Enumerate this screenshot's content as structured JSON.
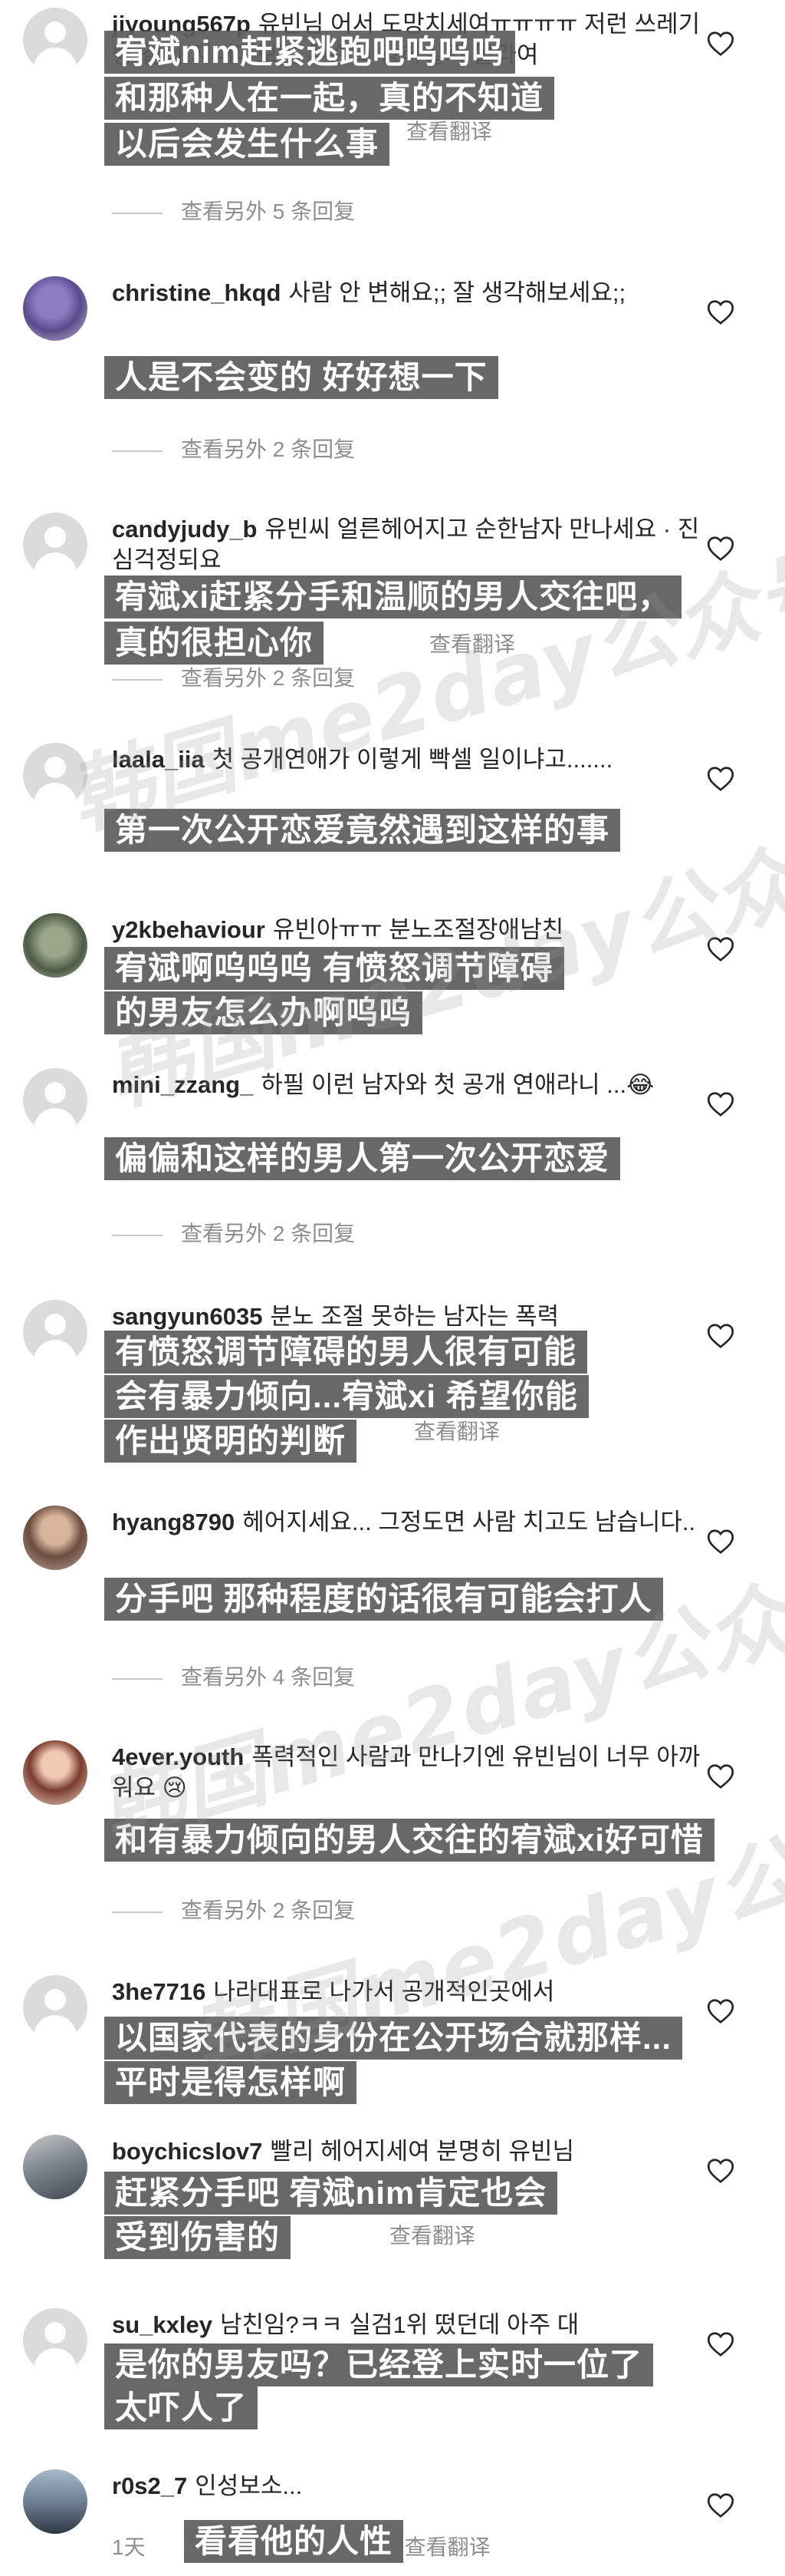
{
  "comments": [
    {
      "username": "jiyoung567p",
      "text": "유빈님 어서 도망치세여ㅠㅠㅠㅠ 저런 쓰레기랑 같이 지내다보면 무슨일 당하실지 몰라여",
      "meta": {
        "time": "",
        "likes": "",
        "reply": "查看翻译"
      },
      "view_replies": "查看另外 5 条回复",
      "subtitle": [
        "宥斌nim赶紧逃跑吧呜呜呜",
        "和那种人在一起，真的不知道",
        "以后会发生什么事"
      ]
    },
    {
      "username": "christine_hkqd",
      "text": "사람 안 변해요;; 잘 생각해보세요;;",
      "view_replies": "查看另外 2 条回复",
      "subtitle": [
        "人是不会变的 好好想一下"
      ]
    },
    {
      "username": "candyjudy_b",
      "text": "유빈씨 얼른헤어지고 순한남자 만나세요 · 진심걱정되요",
      "meta": {
        "reply": "查看翻译"
      },
      "view_replies": "查看另外 2 条回复",
      "subtitle": [
        "宥斌xi赶紧分手和温顺的男人交往吧，",
        "真的很担心你"
      ]
    },
    {
      "username": "laala_iia",
      "text": "첫 공개연애가 이렇게 빡셀 일이냐고.......",
      "subtitle": [
        "第一次公开恋爱竟然遇到这样的事"
      ]
    },
    {
      "username": "y2kbehaviour",
      "text": "유빈아ㅠㅠ 분노조절장애남친",
      "subtitle": [
        "宥斌啊呜呜呜 有愤怒调节障碍",
        "的男友怎么办啊呜呜"
      ]
    },
    {
      "username": "mini_zzang_",
      "text": "하필 이런 남자와 첫 공개 연애라니 ...😂",
      "view_replies": "查看另外 2 条回复",
      "subtitle": [
        "偏偏和这样的男人第一次公开恋爱"
      ]
    },
    {
      "username": "sangyun6035",
      "text": "분노 조절 못하는 남자는 폭력",
      "meta": {
        "reply": "查看翻译"
      },
      "subtitle": [
        "有愤怒调节障碍的男人很有可能",
        "会有暴力倾向...宥斌xi 希望你能",
        "作出贤明的判断"
      ]
    },
    {
      "username": "hyang8790",
      "text": "헤어지세요... 그정도면 사람 치고도 남습니다..",
      "view_replies": "查看另外 4 条回复",
      "subtitle": [
        "分手吧 那种程度的话很有可能会打人"
      ]
    },
    {
      "username": "4ever.youth",
      "text": "폭력적인 사람과 만나기엔 유빈님이 너무 아까워요 😢",
      "view_replies": "查看另外 2 条回复",
      "subtitle": [
        "和有暴力倾向的男人交往的宥斌xi好可惜"
      ]
    },
    {
      "username": "3he7716",
      "text": "나라대표로 나가서 공개적인곳에서",
      "subtitle": [
        "以国家代表的身份在公开场合就那样...",
        "平时是得怎样啊"
      ]
    },
    {
      "username": "boychicslov7",
      "text": "빨리 헤어지세여 분명히 유빈님",
      "meta": {
        "reply": "查看翻译"
      },
      "subtitle": [
        "赶紧分手吧 宥斌nim肯定也会",
        "受到伤害的"
      ]
    },
    {
      "username": "su_kxley",
      "text": "남친임?ㅋㅋ 실검1위 떴던데 아주 대",
      "subtitle": [
        "是你的男友吗？已经登上实时一位了",
        "太吓人了"
      ]
    },
    {
      "username": "r0s2_7",
      "text": "인성보소...",
      "meta": {
        "time": "1天",
        "reply": "查看翻译"
      },
      "subtitle": [
        "看看他的人性"
      ]
    }
  ],
  "watermark": "韩国me2day公众号",
  "icons": {
    "like": "heart-icon",
    "default_avatar": "default-avatar-icon"
  },
  "colors": {
    "text": "#262626",
    "muted": "#8e8e8e",
    "subtitle_bg": "#5c5c5c",
    "subtitle_text": "#ffffff"
  }
}
